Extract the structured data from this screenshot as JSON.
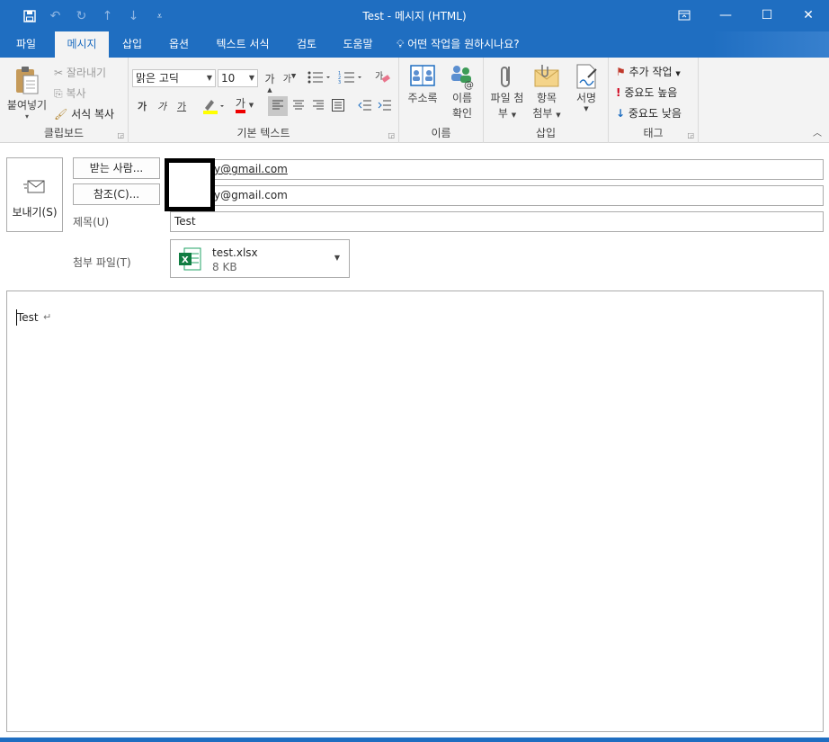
{
  "window": {
    "title": "Test  -  메시지 (HTML)"
  },
  "qat": {
    "save": "save-icon",
    "undo": "undo-icon",
    "redo": "redo-icon",
    "up": "up-arrow-icon",
    "down": "down-arrow-icon",
    "more": "customize-icon"
  },
  "tabs": [
    "파일",
    "메시지",
    "삽입",
    "옵션",
    "텍스트 서식",
    "검토",
    "도움말"
  ],
  "tellme": "어떤 작업을 원하시나요?",
  "ribbon": {
    "clipboard": {
      "label": "클립보드",
      "paste": "붙여넣기",
      "cut": "잘라내기",
      "copy": "복사",
      "format_painter": "서식 복사"
    },
    "basic_text": {
      "label": "기본 텍스트",
      "font": "맑은 고딕",
      "size": "10",
      "bold": "가",
      "italic": "가",
      "underline": "가",
      "font_color": "가"
    },
    "names": {
      "label": "이름",
      "address_book": "주소록",
      "check_names_1": "이름",
      "check_names_2": "확인"
    },
    "include": {
      "label": "삽입",
      "attach_file_1": "파일 첨",
      "attach_file_2": "부",
      "attach_item_1": "항목",
      "attach_item_2": "첨부",
      "signature": "서명"
    },
    "tags": {
      "label": "태그",
      "follow_up": "추가 작업",
      "high_importance": "중요도 높음",
      "low_importance": "중요도 낮음"
    }
  },
  "compose": {
    "send": "보내기(S)",
    "to_button": "받는 사람...",
    "cc_button": "참조(C)...",
    "to_value": "y@gmail.com",
    "cc_value": "y@gmail.com",
    "subject_label": "제목(U)",
    "subject_value": "Test",
    "attach_label": "첨부 파일(T)",
    "attachment": {
      "name": "test.xlsx",
      "size": "8 KB"
    }
  },
  "body": {
    "text": "Test",
    "para_mark": "↵"
  },
  "colors": {
    "accent": "#1f6ec1",
    "ribbon_bg": "#f3f3f3"
  }
}
